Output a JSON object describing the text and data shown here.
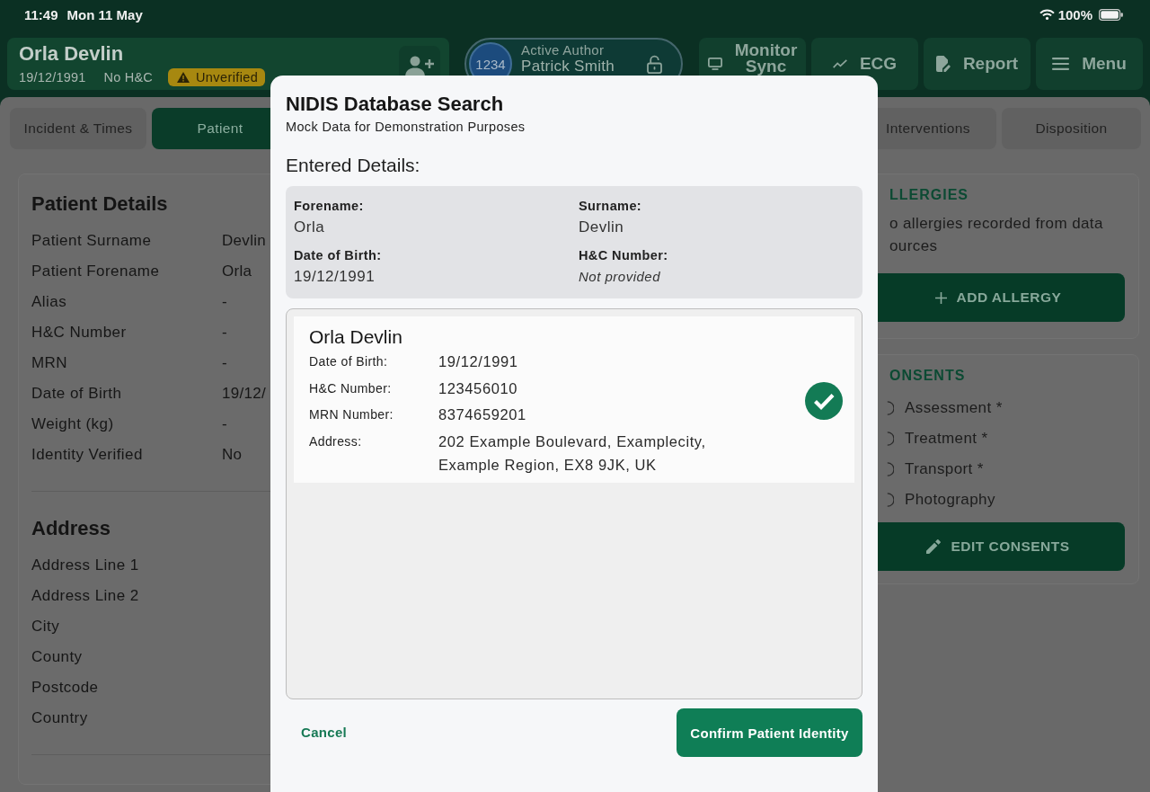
{
  "status_bar": {
    "time": "11:49",
    "date": "Mon 11 May",
    "battery": "100%"
  },
  "header": {
    "patient": {
      "name": "Orla Devlin",
      "dob": "19/12/1991",
      "hc": "No H&C",
      "badge": "Unverified"
    },
    "author": {
      "number": "1234",
      "label": "Active Author",
      "name": "Patrick Smith"
    },
    "buttons": [
      {
        "kind": "monitor",
        "label": "Monitor Sync"
      },
      {
        "kind": "ecg",
        "label": "ECG"
      },
      {
        "kind": "report",
        "label": "Report"
      },
      {
        "kind": "menu",
        "label": "Menu"
      }
    ]
  },
  "tabs": [
    {
      "label": "Incident & Times",
      "selected": false
    },
    {
      "label": "Patient",
      "selected": true
    },
    {
      "label": "Interventions",
      "selected": false
    },
    {
      "label": "Disposition",
      "selected": false
    }
  ],
  "patient_details": {
    "title": "Patient Details",
    "rows": [
      {
        "label": "Patient Surname",
        "value": "Devlin"
      },
      {
        "label": "Patient Forename",
        "value": "Orla"
      },
      {
        "label": "Alias",
        "value": "-"
      },
      {
        "label": "H&C Number",
        "value": "-"
      },
      {
        "label": "MRN",
        "value": "-"
      },
      {
        "label": "Date of Birth",
        "value": "19/12/"
      },
      {
        "label": "Weight (kg)",
        "value": "-"
      },
      {
        "label": "Identity Verified",
        "value": "No"
      }
    ]
  },
  "address": {
    "title": "Address",
    "rows": [
      "Address Line 1",
      "Address Line 2",
      "City",
      "County",
      "Postcode",
      "Country"
    ]
  },
  "allergies": {
    "title": "LLERGIES",
    "message": "o allergies recorded from data ources",
    "button": "ADD ALLERGY"
  },
  "consents": {
    "title": "ONSENTS",
    "items": [
      "Assessment *",
      "Treatment *",
      "Transport *",
      "Photography"
    ],
    "button": "EDIT CONSENTS"
  },
  "dialog": {
    "title": "NIDIS Database Search",
    "subtitle": "Mock Data for Demonstration Purposes",
    "entered_heading": "Entered Details:",
    "entered": [
      {
        "label": "Forename:",
        "value": "Orla",
        "missing": false
      },
      {
        "label": "Surname:",
        "value": "Devlin",
        "missing": false
      },
      {
        "label": "Date of Birth:",
        "value": "19/12/1991",
        "missing": false
      },
      {
        "label": "H&C Number:",
        "value": "Not provided",
        "missing": true
      }
    ],
    "results": [
      {
        "name": "Orla Devlin",
        "selected": true,
        "fields": [
          {
            "label": "Date of Birth:",
            "value": "19/12/1991"
          },
          {
            "label": "H&C Number:",
            "value": "123456010"
          },
          {
            "label": "MRN Number:",
            "value": "8374659201"
          },
          {
            "label": "Address:",
            "value": "202 Example Boulevard, Examplecity, Example Region, EX8 9JK, UK"
          }
        ]
      }
    ],
    "cancel": "Cancel",
    "confirm": "Confirm Patient Identity"
  }
}
